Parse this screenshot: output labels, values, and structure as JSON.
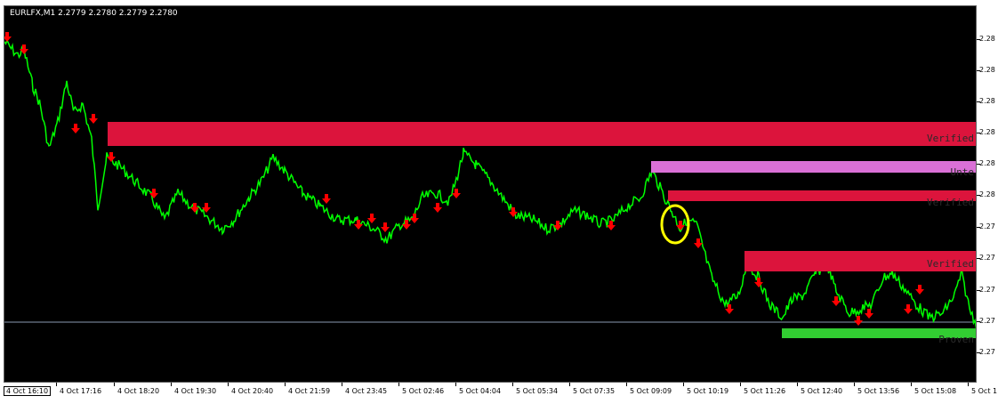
{
  "window": {
    "symbol_line": "EURLFX,M1  2.2779 2.2780 2.2779 2.2780"
  },
  "price_axis": {
    "labels": [
      "2.28",
      "2.28",
      "2.28",
      "2.28",
      "2.28",
      "2.28",
      "2.27",
      "2.27",
      "2.27",
      "2.27",
      "2.27"
    ]
  },
  "time_axis": {
    "first_label": "4 Oct 16:10",
    "labels": [
      "4 Oct 17:16",
      "4 Oct 18:20",
      "4 Oct 19:30",
      "4 Oct 20:40",
      "4 Oct 21:59",
      "4 Oct 23:45",
      "5 Oct 02:46",
      "5 Oct 04:04",
      "5 Oct 05:34",
      "5 Oct 07:35",
      "5 Oct 09:09",
      "5 Oct 10:19",
      "5 Oct 11:26",
      "5 Oct 12:40",
      "5 Oct 13:56",
      "5 Oct 15:08",
      "5 Oct 1"
    ]
  },
  "zones": [
    {
      "label": "Verified",
      "color": "#dc143c"
    },
    {
      "label": "Unte",
      "color": "#da70d6"
    },
    {
      "label": "Verified",
      "color": "#dc143c"
    },
    {
      "label": "Verified",
      "color": "#dc143c"
    },
    {
      "label": "Proven",
      "color": "#32cd32"
    }
  ],
  "colors": {
    "background": "#000000",
    "price_line": "#00ff00",
    "sell_arrow": "#ff0000",
    "highlight": "#ffff00",
    "horizontal_line": "#8a9ab0"
  },
  "icons": {
    "sell_arrow": "down-arrow-icon",
    "highlight": "circle-marker"
  }
}
